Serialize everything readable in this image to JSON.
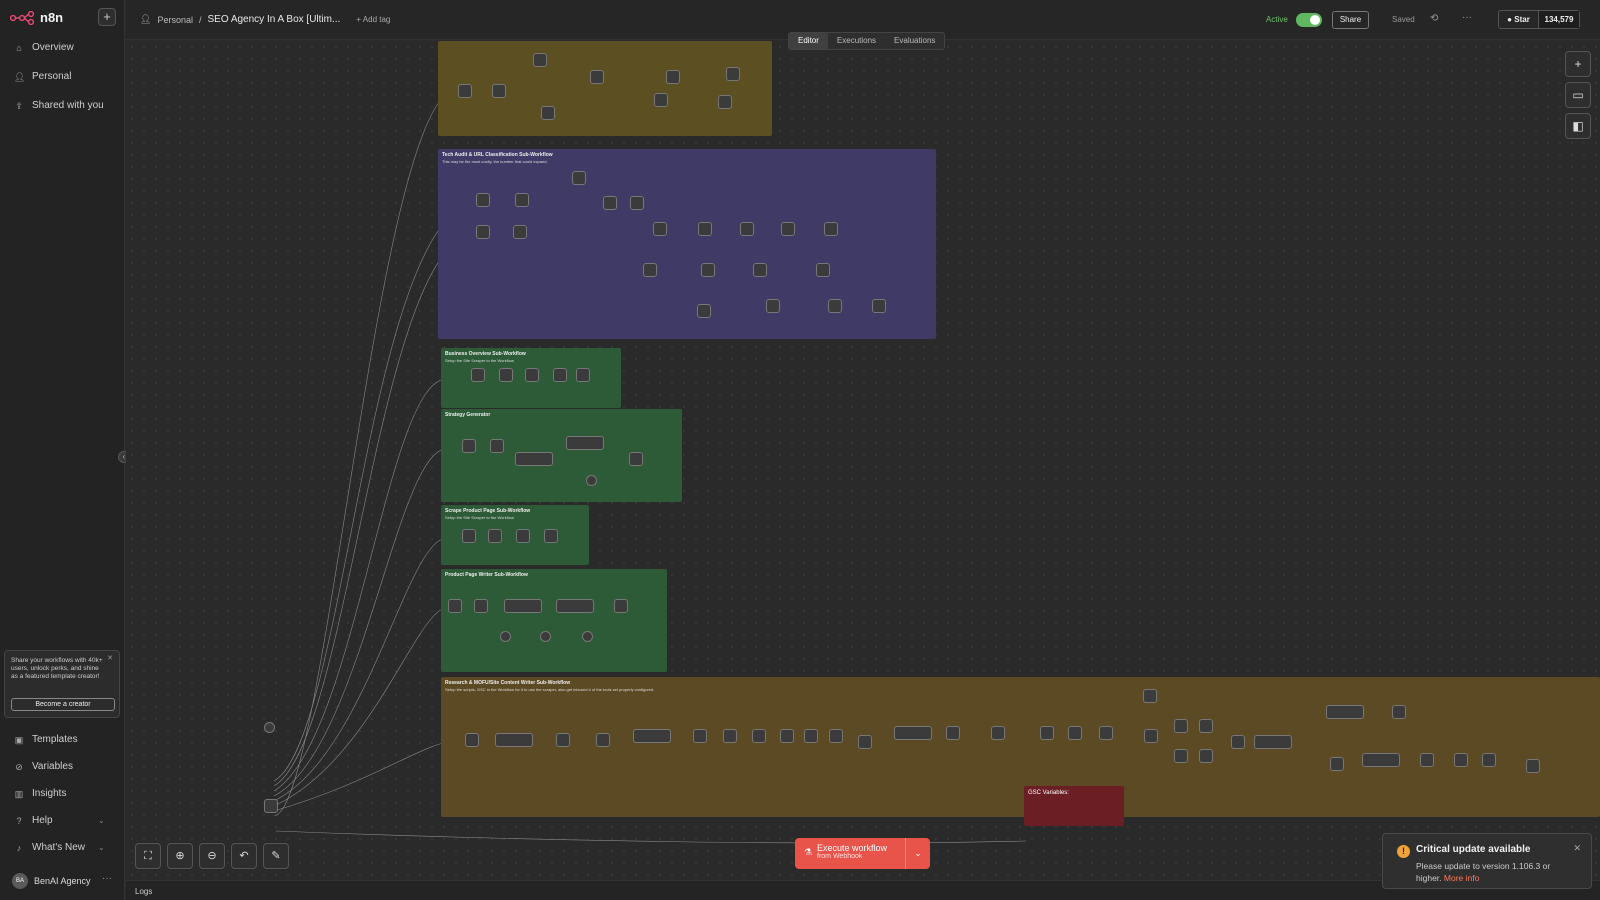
{
  "app": {
    "name": "n8n"
  },
  "sidebar": {
    "items": [
      {
        "label": "Overview"
      },
      {
        "label": "Personal"
      },
      {
        "label": "Shared with you"
      }
    ],
    "bottom_items": [
      {
        "label": "Templates"
      },
      {
        "label": "Variables"
      },
      {
        "label": "Insights"
      },
      {
        "label": "Help"
      },
      {
        "label": "What's New"
      }
    ],
    "promo": {
      "text": "Share your workflows with 40k+ users, unlock perks, and shine as a featured template creator!",
      "button": "Become a creator"
    },
    "user": {
      "initials": "BA",
      "name": "BenAI Agency"
    }
  },
  "header": {
    "project": "Personal",
    "workflow_title": "SEO Agency In A Box [Ultim...",
    "add_tag": "+ Add tag",
    "active_label": "Active",
    "share_label": "Share",
    "saved_label": "Saved",
    "github": {
      "star_label": "Star",
      "count": "134,579"
    }
  },
  "tabs": [
    {
      "label": "Editor",
      "active": true
    },
    {
      "label": "Executions",
      "active": false
    },
    {
      "label": "Evaluations",
      "active": false
    }
  ],
  "canvas": {
    "stickies": [
      {
        "title": "",
        "subtitle": "",
        "color": "#5c5023"
      },
      {
        "title": "Tech Audit & URL Classification Sub-Workflow",
        "subtitle": "This may be the most costly, the number that could expand.",
        "color": "#3f3a66"
      },
      {
        "title": "Business Overview Sub-Workflow",
        "subtitle": "Setup the Site Scraper to the Workflow",
        "color": "#2e5b37"
      },
      {
        "title": "Strategy Generator",
        "subtitle": "",
        "color": "#2e5b37"
      },
      {
        "title": "Scrape Product Page Sub-Workflow",
        "subtitle": "Setup the Site Scraper to the Workflow",
        "color": "#2e5b37"
      },
      {
        "title": "Product Page Writer Sub-Workflow",
        "subtitle": "",
        "color": "#2e5b37"
      },
      {
        "title": "Research & MOFU/Site Content Writer Sub-Workflow",
        "subtitle": "Setup the scripts, GSC in the Workflow for it to use the scraper, also get inbound 4 of the tools set properly configured.",
        "color": "#5c4a24"
      }
    ],
    "gsc_note": {
      "title": "GSC Variables:"
    }
  },
  "execute": {
    "label": "Execute workflow",
    "sub": "from Webhook"
  },
  "logs_label": "Logs",
  "toast": {
    "title": "Critical update available",
    "body": "Please update to version 1.106.3 or higher.",
    "link": "More info"
  },
  "colors": {
    "accent": "#e8534a",
    "active": "#5fb85f",
    "warning": "#f0a33a"
  }
}
